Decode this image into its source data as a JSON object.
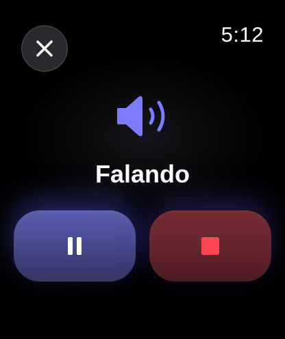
{
  "status_bar": {
    "time": "5:12"
  },
  "close": {
    "icon": "close-icon"
  },
  "now_speaking": {
    "icon": "speaker-wave-icon",
    "label": "Falando"
  },
  "controls": {
    "pause": {
      "icon": "pause-icon"
    },
    "stop": {
      "icon": "stop-icon"
    }
  },
  "colors": {
    "accent": "#7c7cff",
    "stop": "#ff4650",
    "pause_button": "#4a4c93",
    "stop_button": "#6a262e"
  }
}
